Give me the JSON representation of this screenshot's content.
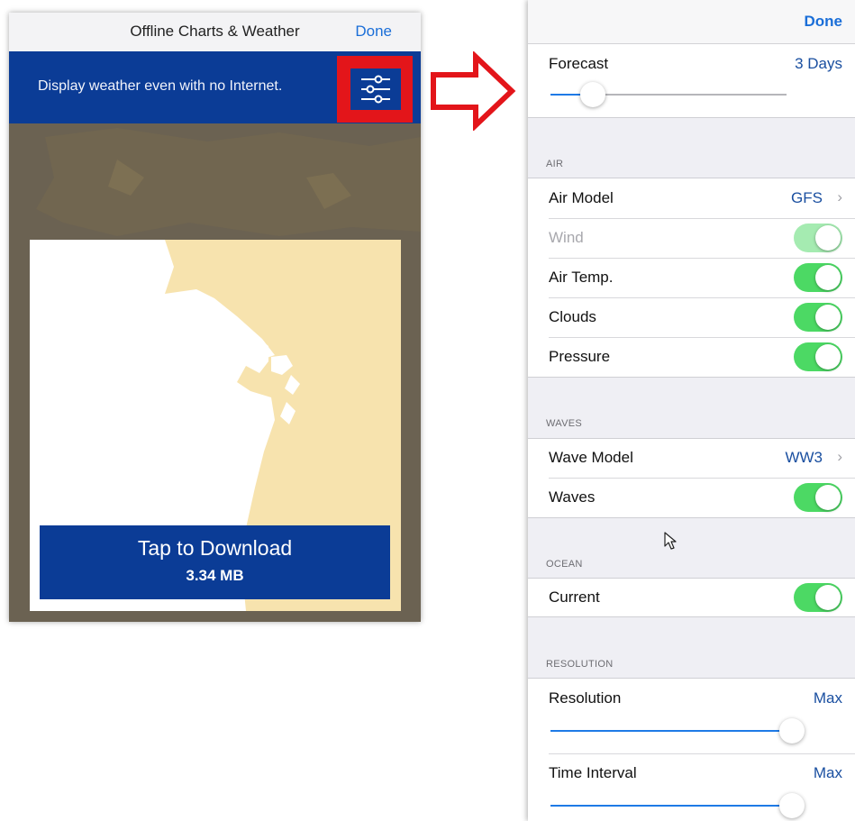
{
  "left_screen": {
    "nav_title": "Offline Charts & Weather",
    "done_label": "Done",
    "banner_text": "Display weather even with no Internet.",
    "settings_icon": "sliders-icon",
    "download_title": "Tap to Download",
    "download_size": "3.34 MB"
  },
  "right_panel": {
    "done_label": "Done",
    "forecast": {
      "label": "Forecast",
      "value": "3 Days",
      "slider_fraction": 0.16
    },
    "air": {
      "header": "AIR",
      "model_label": "Air Model",
      "model_value": "GFS",
      "toggles": [
        {
          "label": "Wind",
          "on": true,
          "disabled": true
        },
        {
          "label": "Air Temp.",
          "on": true
        },
        {
          "label": "Clouds",
          "on": true
        },
        {
          "label": "Pressure",
          "on": true
        }
      ]
    },
    "waves": {
      "header": "WAVES",
      "model_label": "Wave Model",
      "model_value": "WW3",
      "toggles": [
        {
          "label": "Waves",
          "on": true
        }
      ]
    },
    "ocean": {
      "header": "OCEAN",
      "toggles": [
        {
          "label": "Current",
          "on": true
        }
      ]
    },
    "resolution": {
      "header": "RESOLUTION",
      "resolution": {
        "label": "Resolution",
        "value": "Max",
        "slider_fraction": 1.0
      },
      "time_interval": {
        "label": "Time Interval",
        "value": "Max",
        "slider_fraction": 1.0
      }
    }
  },
  "colors": {
    "brand_blue": "#0b3c96",
    "ios_blue": "#1a6ed8",
    "toggle_green": "#4cd964",
    "highlight_red": "#e3151a"
  },
  "icons": {
    "arrow": "right-arrow-icon",
    "chevron": "chevron-right-icon",
    "cursor": "mouse-cursor-icon"
  }
}
